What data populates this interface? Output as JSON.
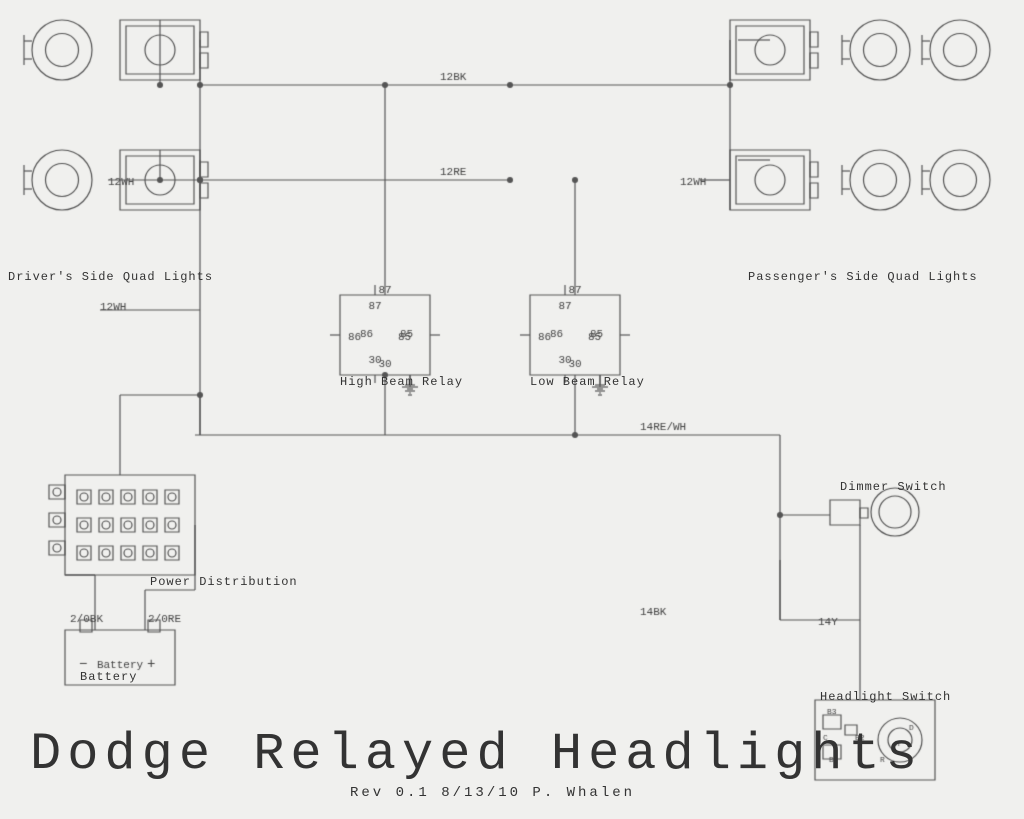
{
  "title": "Dodge Relayed Headlights",
  "subtitle": "Rev 0.1  8/13/10  P. Whalen",
  "labels": {
    "drivers_side": "Driver's Side  Quad Lights",
    "passengers_side": "Passenger's Side  Quad Lights",
    "high_beam_relay": "High Beam Relay",
    "low_beam_relay": "Low Beam Relay",
    "power_distribution": "Power Distribution",
    "battery": "Battery",
    "dimmer_switch": "Dimmer Switch",
    "headlight_switch": "Headlight Switch",
    "wire_12bk": "12BK",
    "wire_12wh_top": "12WH",
    "wire_12re": "12RE",
    "wire_12wh_left": "12WH",
    "wire_12wh_right": "12WH",
    "wire_2_0bk": "2/0BK",
    "wire_2_0re": "2/0RE",
    "wire_14re_wh": "14RE/WH",
    "wire_14bk": "14BK",
    "wire_14y": "14Y"
  },
  "relay_pins": {
    "pin87": "87",
    "pin86": "86",
    "pin85": "85",
    "pin30": "30"
  }
}
